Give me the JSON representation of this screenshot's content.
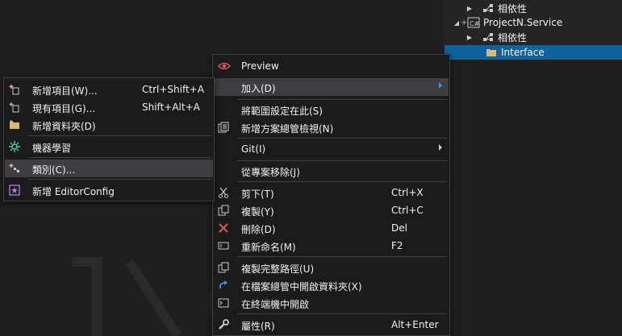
{
  "solution_explorer": {
    "rows": [
      {
        "label": "相依性"
      },
      {
        "label": "ProjectN.Service"
      },
      {
        "label": "相依性"
      },
      {
        "label": "Interface"
      }
    ]
  },
  "context_menu": {
    "items": [
      {
        "label": "Preview",
        "shortcut": "",
        "icon": "eye-icon"
      },
      {
        "label": "加入(D)",
        "shortcut": "",
        "icon": ""
      },
      {
        "label": "將範圍設定在此(S)",
        "shortcut": "",
        "icon": ""
      },
      {
        "label": "新增方案總管檢視(N)",
        "shortcut": "",
        "icon": "new-view-icon"
      },
      {
        "label": "Git(I)",
        "shortcut": "",
        "icon": ""
      },
      {
        "label": "從專案移除(J)",
        "shortcut": "",
        "icon": ""
      },
      {
        "label": "剪下(T)",
        "shortcut": "Ctrl+X",
        "icon": "scissors-icon"
      },
      {
        "label": "複製(Y)",
        "shortcut": "Ctrl+C",
        "icon": "copy-icon"
      },
      {
        "label": "刪除(D)",
        "shortcut": "Del",
        "icon": "delete-x-icon"
      },
      {
        "label": "重新命名(M)",
        "shortcut": "F2",
        "icon": "rename-icon"
      },
      {
        "label": "複製完整路徑(U)",
        "shortcut": "",
        "icon": "copy-path-icon"
      },
      {
        "label": "在檔案總管中開啟資料夾(X)",
        "shortcut": "",
        "icon": "refresh-arrow-icon"
      },
      {
        "label": "在終端機中開啟",
        "shortcut": "",
        "icon": "terminal-icon"
      },
      {
        "label": "屬性(R)",
        "shortcut": "Alt+Enter",
        "icon": "wrench-icon"
      }
    ]
  },
  "add_submenu": {
    "items": [
      {
        "label": "新增項目(W)...",
        "shortcut": "Ctrl+Shift+A",
        "icon": "new-item-icon"
      },
      {
        "label": "現有項目(G)...",
        "shortcut": "Shift+Alt+A",
        "icon": "existing-item-icon"
      },
      {
        "label": "新增資料夾(D)",
        "shortcut": "",
        "icon": "new-folder-icon"
      },
      {
        "label": "機器學習",
        "shortcut": "",
        "icon": "ml-icon"
      },
      {
        "label": "類別(C)...",
        "shortcut": "",
        "icon": "class-icon"
      },
      {
        "label": "新增 EditorConfig",
        "shortcut": "",
        "icon": "editorconfig-icon"
      }
    ]
  },
  "colors": {
    "selection": "#0e639c",
    "menu_bg": "#1b1b1c",
    "hover": "#3e3e40",
    "accent_red": "#e05252",
    "accent_blue": "#3794ff"
  }
}
